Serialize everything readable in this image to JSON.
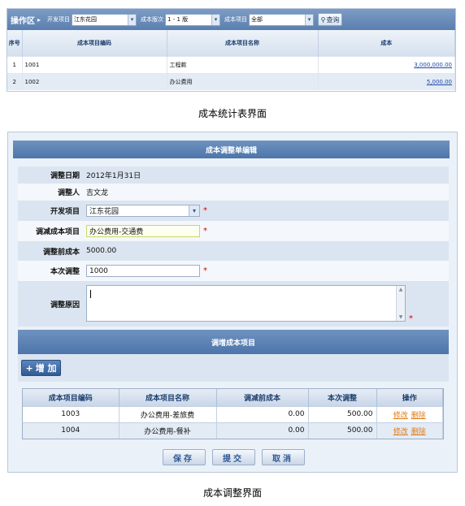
{
  "stats_view": {
    "toolbar": {
      "zone_label": "操作区",
      "arrow": "▸",
      "project_label": "开发项目",
      "project_value": "江东花园",
      "phase_label": "成本版次",
      "phase_value": "1 - 1 版",
      "item_label": "成本项目",
      "item_value": "全部",
      "query_label": "查询",
      "query_icon": "magnifier-icon"
    },
    "columns": [
      "序号",
      "成本项目编码",
      "成本项目名称",
      "成本"
    ],
    "rows": [
      {
        "index": "1",
        "code": "1001",
        "name": "工程款",
        "cost": "3,000,000.00"
      },
      {
        "index": "2",
        "code": "1002",
        "name": "办公费用",
        "cost": "5,000.00"
      }
    ],
    "caption": "成本统计表界面"
  },
  "adjust_view": {
    "title": "成本调整单编辑",
    "fields": {
      "date_label": "调整日期",
      "date_value": "2012年1月31日",
      "person_label": "调整人",
      "person_value": "吉文龙",
      "project_label": "开发项目",
      "project_value": "江东花园",
      "reduce_item_label": "调减成本项目",
      "reduce_item_value": "办公费用-交通费",
      "before_cost_label": "调整前成本",
      "before_cost_value": "5000.00",
      "amount_label": "本次调整",
      "amount_value": "1000",
      "reason_label": "调整原因",
      "reason_value": "",
      "required_mark": "*"
    },
    "increase_section": {
      "title": "调增成本项目",
      "add_label": "增 加",
      "add_icon": "plus-icon",
      "columns": [
        "成本项目编码",
        "成本项目名称",
        "调减前成本",
        "本次调整",
        "操作"
      ],
      "rows": [
        {
          "code": "1003",
          "name": "办公费用-差旅费",
          "before": "0.00",
          "amount": "500.00",
          "edit": "修改",
          "delete": "删除"
        },
        {
          "code": "1004",
          "name": "办公费用-餐补",
          "before": "0.00",
          "amount": "500.00",
          "edit": "修改",
          "delete": "删除"
        }
      ]
    },
    "buttons": {
      "save": "保存",
      "submit": "提交",
      "cancel": "取消"
    },
    "caption": "成本调整界面"
  },
  "colors": {
    "toolbar_blue": "#5a7fb0",
    "title_blue": "#4d75aa",
    "row_alt": "#e3ebf5",
    "link_blue": "#1f47a8",
    "action_orange": "#e37b14",
    "required_red": "#d40000"
  }
}
